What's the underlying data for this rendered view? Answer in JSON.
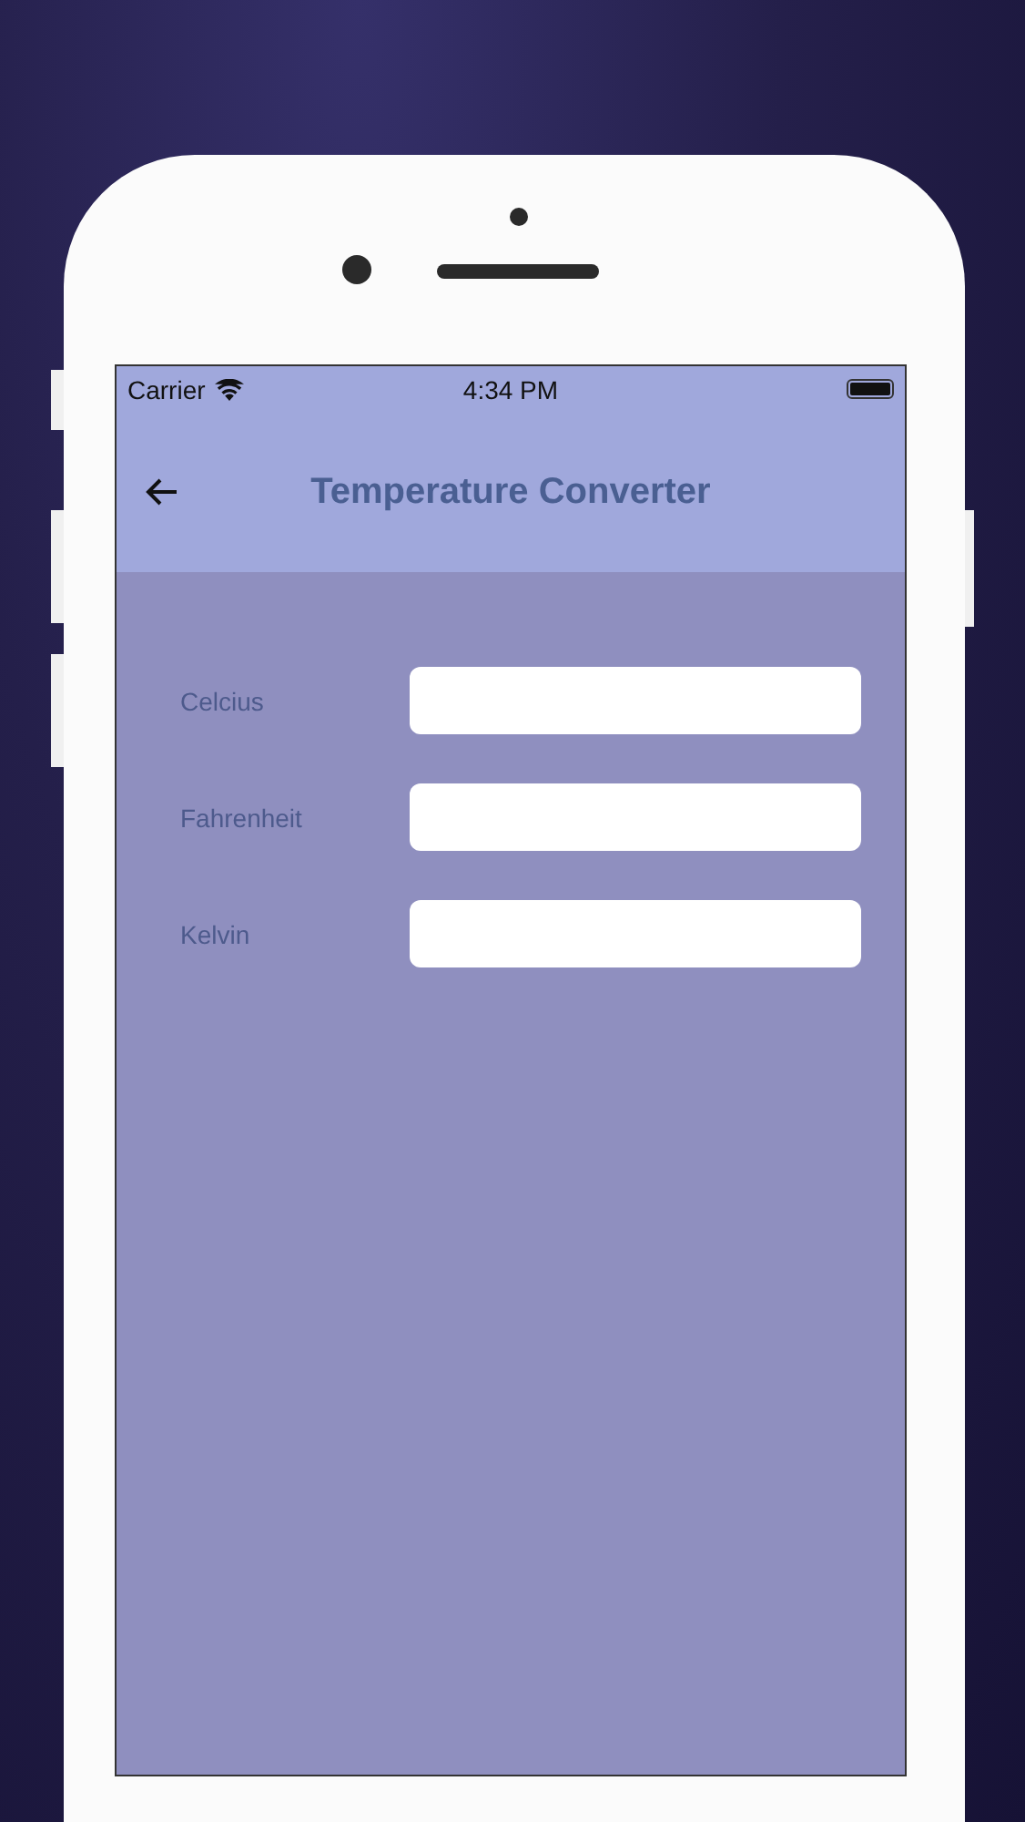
{
  "status_bar": {
    "carrier": "Carrier",
    "time": "4:34 PM"
  },
  "app_bar": {
    "title": "Temperature Converter"
  },
  "fields": [
    {
      "label": "Celcius"
    },
    {
      "label": "Fahrenheit"
    },
    {
      "label": "Kelvin"
    }
  ]
}
